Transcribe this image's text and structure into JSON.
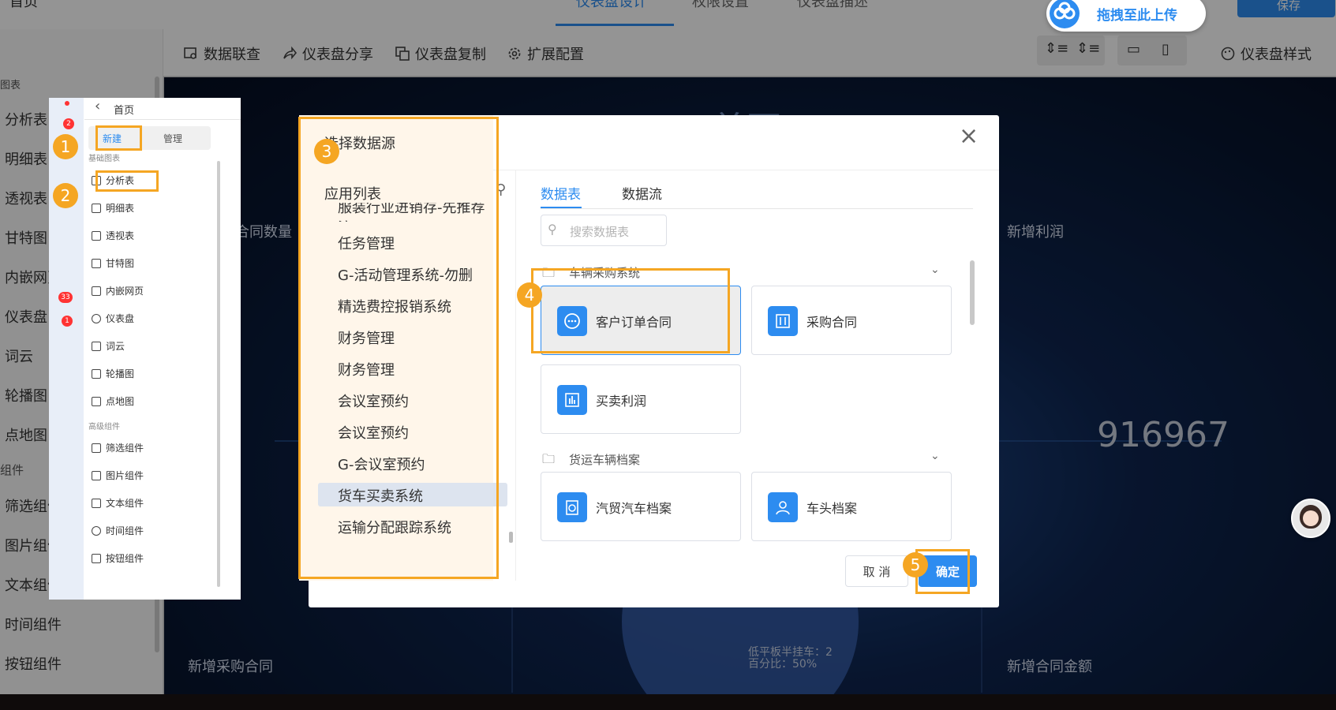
{
  "header": {
    "home_label": "首页",
    "tabs": [
      "仪表盘设计",
      "权限设置",
      "仪表盘描述"
    ],
    "upload_label": "拖拽至此上传",
    "save_label": "保存"
  },
  "toolbar": {
    "new_label": "新建",
    "manage_label": "管理",
    "items": [
      "数据联查",
      "仪表盘分享",
      "仪表盘复制",
      "扩展配置"
    ],
    "style_label": "仪表盘样式"
  },
  "left_panel": {
    "section_label": "图表",
    "items": [
      "分析表",
      "明细表",
      "透视表",
      "甘特图",
      "内嵌网页",
      "仪表盘",
      "词云",
      "轮播图",
      "点地图"
    ],
    "section2_label": "组件",
    "items2": [
      "筛选组件",
      "图片组件",
      "文本组件",
      "时间组件",
      "按钮组件"
    ]
  },
  "canvas": {
    "title_partial": "首页",
    "contract_count_label": "合同数量",
    "new_profit_label": "新增利润",
    "big_number": "916967",
    "new_purchase_label": "新增采购合同",
    "new_contract_amount_label": "新增合同金额",
    "tooltip_line1": "低平板半挂车：2",
    "tooltip_line2": "百分比：50%"
  },
  "inset": {
    "home_label": "首页",
    "new_label": "新建",
    "manage_label": "管理",
    "basic_section": "基础图表",
    "basic_items": [
      "分析表",
      "明细表",
      "透视表",
      "甘特图",
      "内嵌网页",
      "仪表盘",
      "词云",
      "轮播图",
      "点地图"
    ],
    "advanced_section": "高级组件",
    "advanced_items": [
      "筛选组件",
      "图片组件",
      "文本组件",
      "时间组件",
      "按钮组件"
    ],
    "badge_counts": [
      "2",
      "33",
      "1"
    ]
  },
  "dialog": {
    "title": "选择数据源",
    "app_list_label": "应用列表",
    "apps": [
      "服装行业进销存-先推荐注",
      "任务管理",
      "G-活动管理系统-勿删",
      "精选费控报销系统",
      "财务管理",
      "财务管理",
      "会议室预约",
      "会议室预约",
      "G-会议室预约",
      "货车买卖系统",
      "运输分配跟踪系统"
    ],
    "selected_app": "货车买卖系统",
    "tabs": [
      "数据表",
      "数据流"
    ],
    "search_placeholder": "搜索数据表",
    "groups": [
      {
        "name": "车辆采购系统",
        "cards": [
          "客户订单合同",
          "采购合同",
          "买卖利润"
        ]
      },
      {
        "name": "货运车辆档案",
        "cards": [
          "汽贸汽车档案",
          "车头档案"
        ]
      }
    ],
    "cancel_label": "取 消",
    "confirm_label": "确定"
  },
  "steps": [
    "1",
    "2",
    "3",
    "4",
    "5"
  ],
  "colors": {
    "accent": "#2d8cf0",
    "highlight": "#f5a623",
    "app_panel_bg": "#fff6ea"
  }
}
